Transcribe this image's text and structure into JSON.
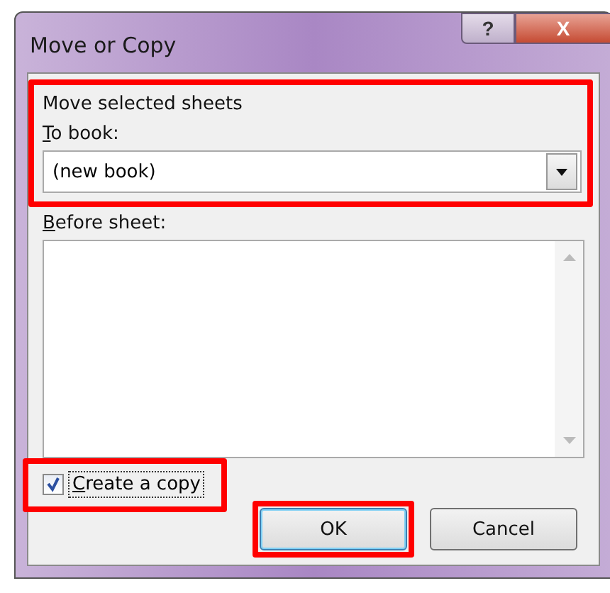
{
  "window": {
    "title": "Move or Copy",
    "buttons": [
      {
        "kind": "help",
        "label": "?"
      },
      {
        "kind": "close",
        "label": "X"
      }
    ]
  },
  "heading": "Move selected sheets",
  "to_book": {
    "label": "To book:",
    "access_key_underlined": true,
    "value": "(new book)",
    "highlighted": true
  },
  "before_sheet": {
    "label": "Before sheet:",
    "access_key_underlined": true
  },
  "create_copy": {
    "label": "Create a copy",
    "access_key_underlined": true,
    "checked": true,
    "focused": true,
    "highlighted": true
  },
  "buttons": [
    {
      "label": "OK",
      "default": true,
      "highlighted": true
    },
    {
      "label": "Cancel",
      "default": false,
      "highlighted": false
    }
  ]
}
